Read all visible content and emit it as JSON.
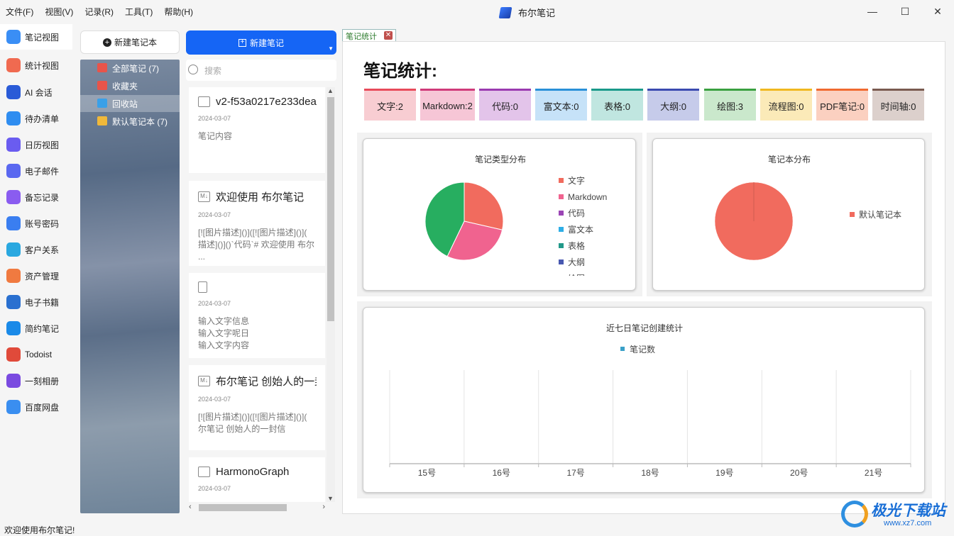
{
  "menu": [
    "文件(F)",
    "视图(V)",
    "记录(R)",
    "工具(T)",
    "帮助(H)"
  ],
  "app_title": "布尔笔记",
  "window_controls": {
    "minimize": "—",
    "maximize": "☐",
    "close": "✕"
  },
  "sidebar": {
    "items": [
      {
        "label": "笔记视图",
        "icon": "notes-icon",
        "color": "#3a8ef5",
        "active": true
      },
      {
        "label": "统计视图",
        "icon": "chart-icon",
        "color": "#f06a50"
      },
      {
        "label": "AI 会话",
        "icon": "ai-chat-icon",
        "color": "#2a5bd7"
      },
      {
        "label": "待办清单",
        "icon": "todo-icon",
        "color": "#2f8df0"
      },
      {
        "label": "日历视图",
        "icon": "calendar-icon",
        "color": "#6a5cf0"
      },
      {
        "label": "电子邮件",
        "icon": "mail-icon",
        "color": "#5a68f0"
      },
      {
        "label": "备忘记录",
        "icon": "memo-icon",
        "color": "#8a5cf0"
      },
      {
        "label": "账号密码",
        "icon": "password-icon",
        "color": "#3a7ef0"
      },
      {
        "label": "客户关系",
        "icon": "customer-icon",
        "color": "#2aa8e0"
      },
      {
        "label": "资产管理",
        "icon": "asset-icon",
        "color": "#f07a40"
      },
      {
        "label": "电子书籍",
        "icon": "ebook-icon",
        "color": "#2a70d0"
      },
      {
        "label": "简约笔记",
        "icon": "simple-note-icon",
        "color": "#1a8ae8"
      },
      {
        "label": "Todoist",
        "icon": "todoist-icon",
        "color": "#e04a3a"
      },
      {
        "label": "一刻相册",
        "icon": "album-icon",
        "color": "#7a4ae0"
      },
      {
        "label": "百度网盘",
        "icon": "netdisk-icon",
        "color": "#3a8ef0"
      }
    ]
  },
  "notebooks": {
    "new_label": "新建笔记本",
    "items": [
      {
        "label": "全部笔记 (7)",
        "icon": "home-icon",
        "color": "#e8544a"
      },
      {
        "label": "收藏夹",
        "icon": "favorites-icon",
        "color": "#e8544a"
      },
      {
        "label": "回收站",
        "icon": "trash-icon",
        "color": "#3aa0e8",
        "selected": true
      },
      {
        "label": "默认笔记本 (7)",
        "icon": "folder-icon",
        "color": "#f0b83a"
      }
    ]
  },
  "notes": {
    "new_label": "新建笔记",
    "search_placeholder": "搜索",
    "items": [
      {
        "title": "v2-f53a0217e233dea",
        "type_icon": "image-icon",
        "date": "2024-03-07",
        "body": "笔记内容"
      },
      {
        "title": "欢迎使用 布尔笔记",
        "type_icon": "markdown-icon",
        "date": "2024-03-07",
        "body": "[![图片描述]()]([![图片描述]()](\n描述]()]()`代码`# 欢迎使用 布尔\n..."
      },
      {
        "title": "",
        "type_icon": "document-icon",
        "date": "2024-03-07",
        "body": "输入文字信息\n输入文字呢日\n输入文字内容"
      },
      {
        "title": "布尔笔记 创始人的一封",
        "type_icon": "markdown-icon",
        "date": "2024-03-07",
        "body": "[![图片描述]()]([![图片描述]()](\n尔笔记 创始人的一封信"
      },
      {
        "title": "HarmonoGraph",
        "type_icon": "image-icon",
        "date": "2024-03-07",
        "body": ""
      }
    ]
  },
  "tab": {
    "label": "笔记统计",
    "close": "✕"
  },
  "page_title": "笔记统计:",
  "stats": [
    {
      "label": "文字:2",
      "bg": "#f8cdd2",
      "line": "#e84a5a"
    },
    {
      "label": "Markdown:2",
      "bg": "#f6c6d6",
      "line": "#d03a7a"
    },
    {
      "label": "代码:0",
      "bg": "#e3c4ea",
      "line": "#9a3ab0"
    },
    {
      "label": "富文本:0",
      "bg": "#c6e2f8",
      "line": "#2a90d8"
    },
    {
      "label": "表格:0",
      "bg": "#c0e6e0",
      "line": "#1a9a8a"
    },
    {
      "label": "大纲:0",
      "bg": "#c6cbea",
      "line": "#3a4ab0"
    },
    {
      "label": "绘图:3",
      "bg": "#cae8cc",
      "line": "#3aa040"
    },
    {
      "label": "流程图:0",
      "bg": "#fbeab8",
      "line": "#f0b820"
    },
    {
      "label": "PDF笔记:0",
      "bg": "#fbd0c0",
      "line": "#f06a30"
    },
    {
      "label": "时间轴:0",
      "bg": "#dcd0cc",
      "line": "#7a5a50"
    }
  ],
  "chart_data": [
    {
      "type": "pie",
      "title": "笔记类型分布",
      "categories": [
        "文字",
        "Markdown",
        "代码",
        "富文本",
        "表格",
        "大纲",
        "绘图"
      ],
      "values": [
        2,
        2,
        0,
        0,
        0,
        0,
        3
      ],
      "colors": [
        "#f16b5e",
        "#f0638f",
        "#9b45b5",
        "#2eaee6",
        "#22998a",
        "#4858b0",
        "#27ae60"
      ],
      "legend": "right"
    },
    {
      "type": "pie",
      "title": "笔记本分布",
      "categories": [
        "默认笔记本"
      ],
      "values": [
        7
      ],
      "colors": [
        "#f16b5e"
      ],
      "legend": "right"
    },
    {
      "type": "bar",
      "title": "近七日笔记创建统计",
      "categories": [
        "15号",
        "16号",
        "17号",
        "18号",
        "19号",
        "20号",
        "21号"
      ],
      "series": [
        {
          "name": "笔记数",
          "values": [
            0,
            0,
            0,
            0,
            0,
            0,
            0
          ],
          "color": "#3aa0c8"
        }
      ],
      "legend": "top",
      "grid": true
    }
  ],
  "status_text": "欢迎使用布尔笔记!",
  "watermark": {
    "text": "极光下载站",
    "url": "www.xz7.com"
  }
}
